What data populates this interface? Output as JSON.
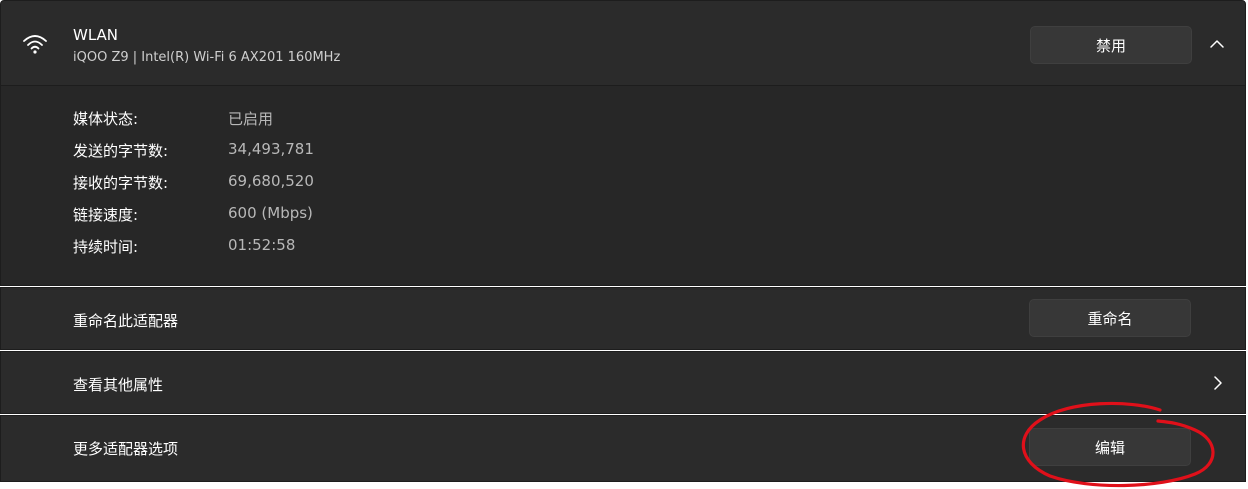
{
  "adapter": {
    "title": "WLAN",
    "subtitle": "iQOO Z9 | Intel(R) Wi-Fi 6 AX201 160MHz",
    "disable_button": "禁用",
    "wifi_icon": "wifi-icon",
    "collapse_icon": "chevron-up-icon"
  },
  "details": [
    {
      "label": "媒体状态:",
      "value": "已启用"
    },
    {
      "label": "发送的字节数:",
      "value": "34,493,781"
    },
    {
      "label": "接收的字节数:",
      "value": "69,680,520"
    },
    {
      "label": "链接速度:",
      "value": "600 (Mbps)"
    },
    {
      "label": "持续时间:",
      "value": "01:52:58"
    }
  ],
  "rename_row": {
    "label": "重命名此适配器",
    "button": "重命名"
  },
  "properties_row": {
    "label": "查看其他属性",
    "icon": "chevron-right-icon"
  },
  "more_options_row": {
    "label": "更多适配器选项",
    "button": "编辑"
  },
  "colors": {
    "card_background": "#2b2b2b",
    "details_background": "#272727",
    "button_background": "#373737",
    "annotation_red": "#e0101a"
  }
}
